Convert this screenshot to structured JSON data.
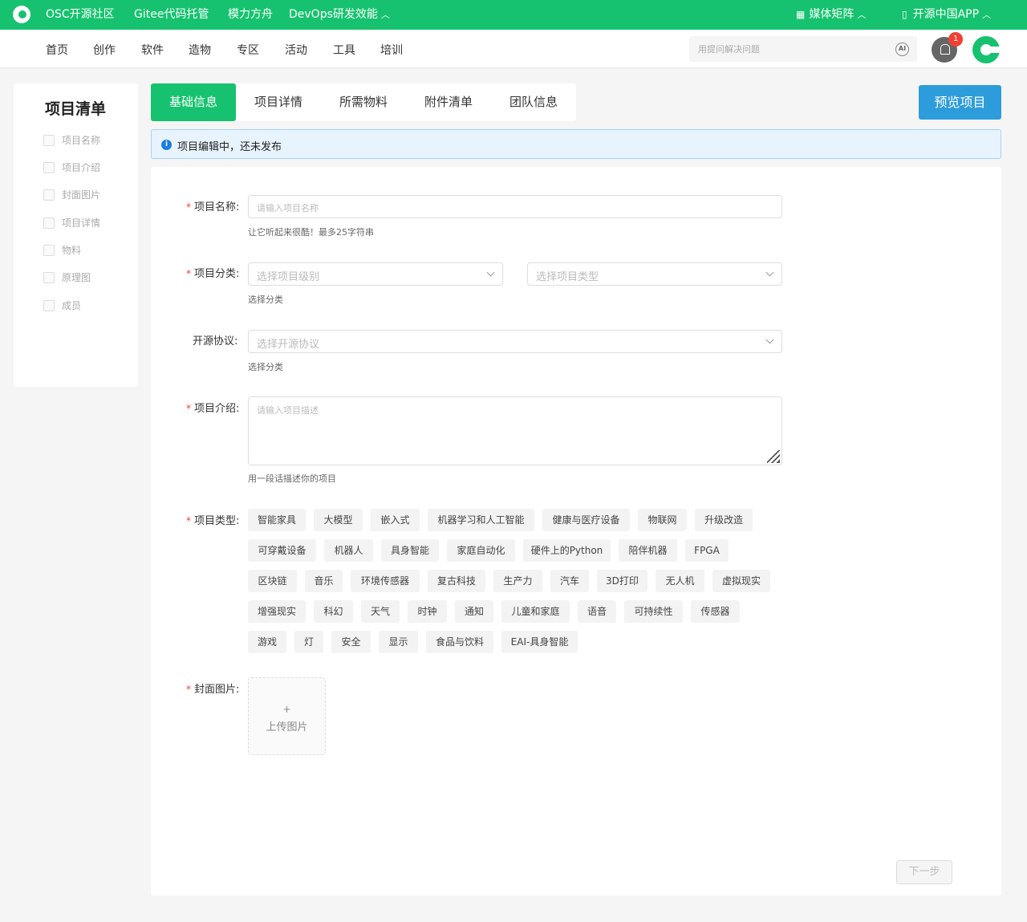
{
  "topbar": {
    "links": [
      "OSC开源社区",
      "Gitee代码托管",
      "模力方舟",
      "DevOps研发效能"
    ],
    "media": "媒体矩阵",
    "app": "开源中国APP"
  },
  "nav": {
    "items": [
      "首页",
      "创作",
      "软件",
      "造物",
      "专区",
      "活动",
      "工具",
      "培训"
    ],
    "search_placeholder": "用提问解决问题",
    "ai_label": "AI",
    "notification_count": "1"
  },
  "sidebar": {
    "title": "项目清单",
    "items": [
      "项目名称",
      "项目介绍",
      "封面图片",
      "项目详情",
      "物料",
      "原理图",
      "成员"
    ]
  },
  "tabs": [
    "基础信息",
    "项目详情",
    "所需物料",
    "附件清单",
    "团队信息"
  ],
  "preview_label": "预览项目",
  "alert": "项目编辑中，还未发布",
  "form": {
    "name_label": "项目名称:",
    "name_placeholder": "请输入项目名称",
    "name_hint": "让它听起来很酷！最多25字符串",
    "category_label": "项目分类:",
    "level_placeholder": "选择项目级别",
    "type_placeholder": "选择项目类型",
    "category_hint": "选择分类",
    "license_label": "开源协议:",
    "license_placeholder": "选择开源协议",
    "license_hint": "选择分类",
    "intro_label": "项目介绍:",
    "intro_placeholder": "请输入项目描述",
    "intro_hint": "用一段话描述你的项目",
    "tags_label": "项目类型:",
    "tags": [
      "智能家具",
      "大模型",
      "嵌入式",
      "机器学习和人工智能",
      "健康与医疗设备",
      "物联网",
      "升级改造",
      "可穿戴设备",
      "机器人",
      "具身智能",
      "家庭自动化",
      "硬件上的Python",
      "陪伴机器",
      "FPGA",
      "区块链",
      "音乐",
      "环境传感器",
      "复古科技",
      "生产力",
      "汽车",
      "3D打印",
      "无人机",
      "虚拟现实",
      "增强现实",
      "科幻",
      "天气",
      "时钟",
      "通知",
      "儿童和家庭",
      "语音",
      "可持续性",
      "传感器",
      "游戏",
      "灯",
      "安全",
      "显示",
      "食品与饮料",
      "EAI-具身智能"
    ],
    "cover_label": "封面图片:",
    "upload_plus": "+",
    "upload_label": "上传图片",
    "next_label": "下一步"
  },
  "colors": {
    "brand": "#16c26f",
    "accent_blue": "#2d9cdb",
    "required": "#f04134"
  }
}
